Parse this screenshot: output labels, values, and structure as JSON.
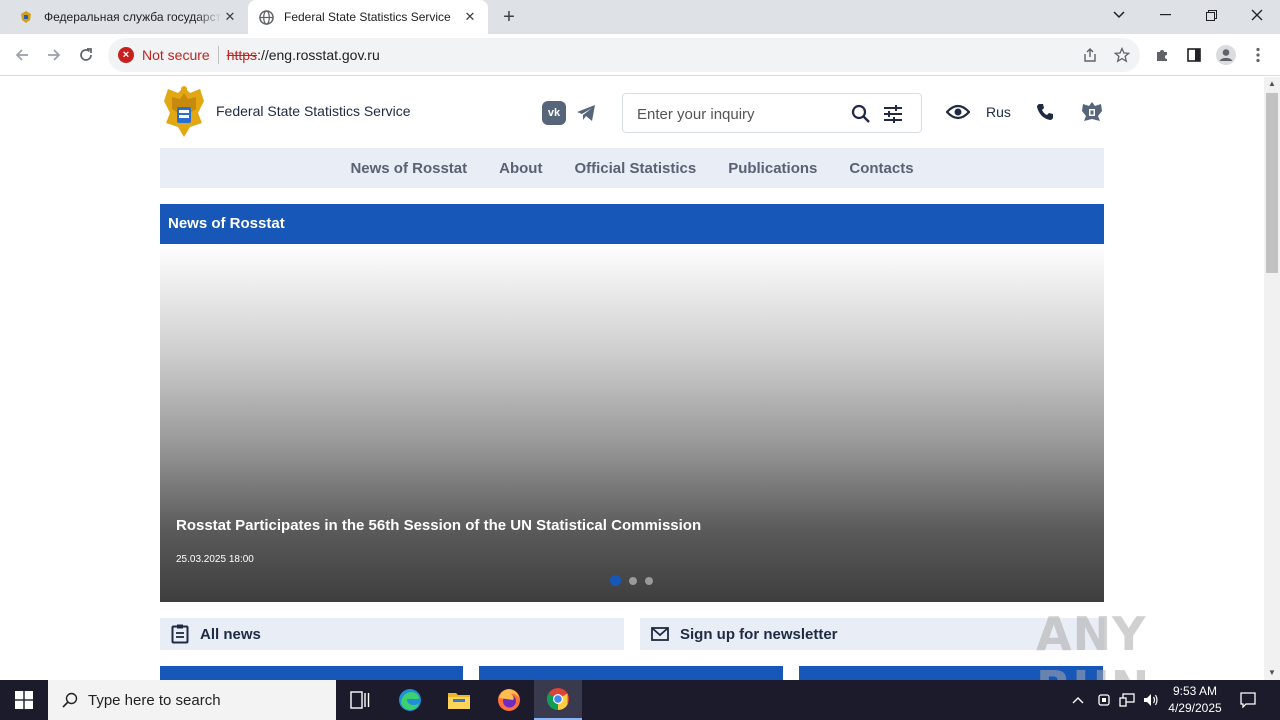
{
  "browser": {
    "tabs": [
      {
        "title": "Федеральная служба государственной статистики",
        "active": false
      },
      {
        "title": "Federal State Statistics Service",
        "active": true
      }
    ],
    "address": {
      "security_label": "Not secure",
      "scheme": "https",
      "rest": "://eng.rosstat.gov.ru"
    }
  },
  "site": {
    "name": "Federal State Statistics Service",
    "social": {
      "vk": "vk"
    },
    "search_placeholder": "Enter your inquiry",
    "lang": "Rus",
    "nav": [
      "News of Rosstat",
      "About",
      "Official Statistics",
      "Publications",
      "Contacts"
    ],
    "news_header": "News of Rosstat",
    "slide": {
      "title": "Rosstat Participates in the 56th Session of the UN Statistical Commission",
      "date": "25.03.2025 18:00",
      "count": 3,
      "active_index": 0
    },
    "links": {
      "all_news": "All news",
      "newsletter": "Sign up for newsletter"
    },
    "colors": {
      "primary": "#1757b8",
      "nav_bg": "#e8edf6"
    }
  },
  "watermark": "ANY RUN",
  "taskbar": {
    "search_placeholder": "Type here to search",
    "time": "9:53 AM",
    "date": "4/29/2025"
  }
}
